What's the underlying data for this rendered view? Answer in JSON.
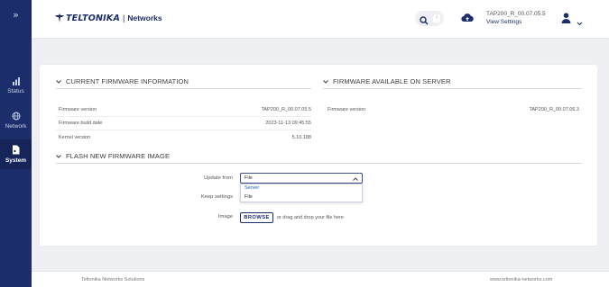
{
  "sidebar": {
    "toggle": "»",
    "items": [
      {
        "label": "Status",
        "icon": "signal-bars-icon"
      },
      {
        "label": "Network",
        "icon": "globe-icon"
      },
      {
        "label": "System",
        "icon": "document-icon"
      }
    ]
  },
  "header": {
    "logo_name": "TELTONIKA",
    "logo_separator": "|",
    "logo_sub": "Networks",
    "search_shortcut": "/",
    "firmware_version": "TAP200_R_00.07.05.5",
    "view_settings": "View Settings"
  },
  "current_fw": {
    "title": "CURRENT FIRMWARE INFORMATION",
    "rows": [
      {
        "key": "Firmware version",
        "value": "TAP200_R_00.07.05.5"
      },
      {
        "key": "Firmware build date",
        "value": "2023-11-13 09:45:55"
      },
      {
        "key": "Kernel version",
        "value": "5.10.188"
      }
    ]
  },
  "server_fw": {
    "title": "FIRMWARE AVAILABLE ON SERVER",
    "rows": [
      {
        "key": "Firmware version",
        "value": "TAP200_R_00.07.06.3"
      }
    ]
  },
  "flash": {
    "title": "FLASH NEW FIRMWARE IMAGE",
    "update_from_label": "Update from",
    "update_from_value": "File",
    "options": [
      "Server",
      "File"
    ],
    "keep_settings_label": "Keep settings",
    "image_label": "Image",
    "browse_label": "BROWSE",
    "drop_text": "or drag and drop your file here"
  },
  "footer": {
    "left": "Teltonika Networks Solutions",
    "right": "www.teltonika-networks.com"
  },
  "colors": {
    "sidebar": "#1c2d6b",
    "accent": "#1c2d6b",
    "link": "#1c5bbf",
    "background": "#eef0f4"
  }
}
